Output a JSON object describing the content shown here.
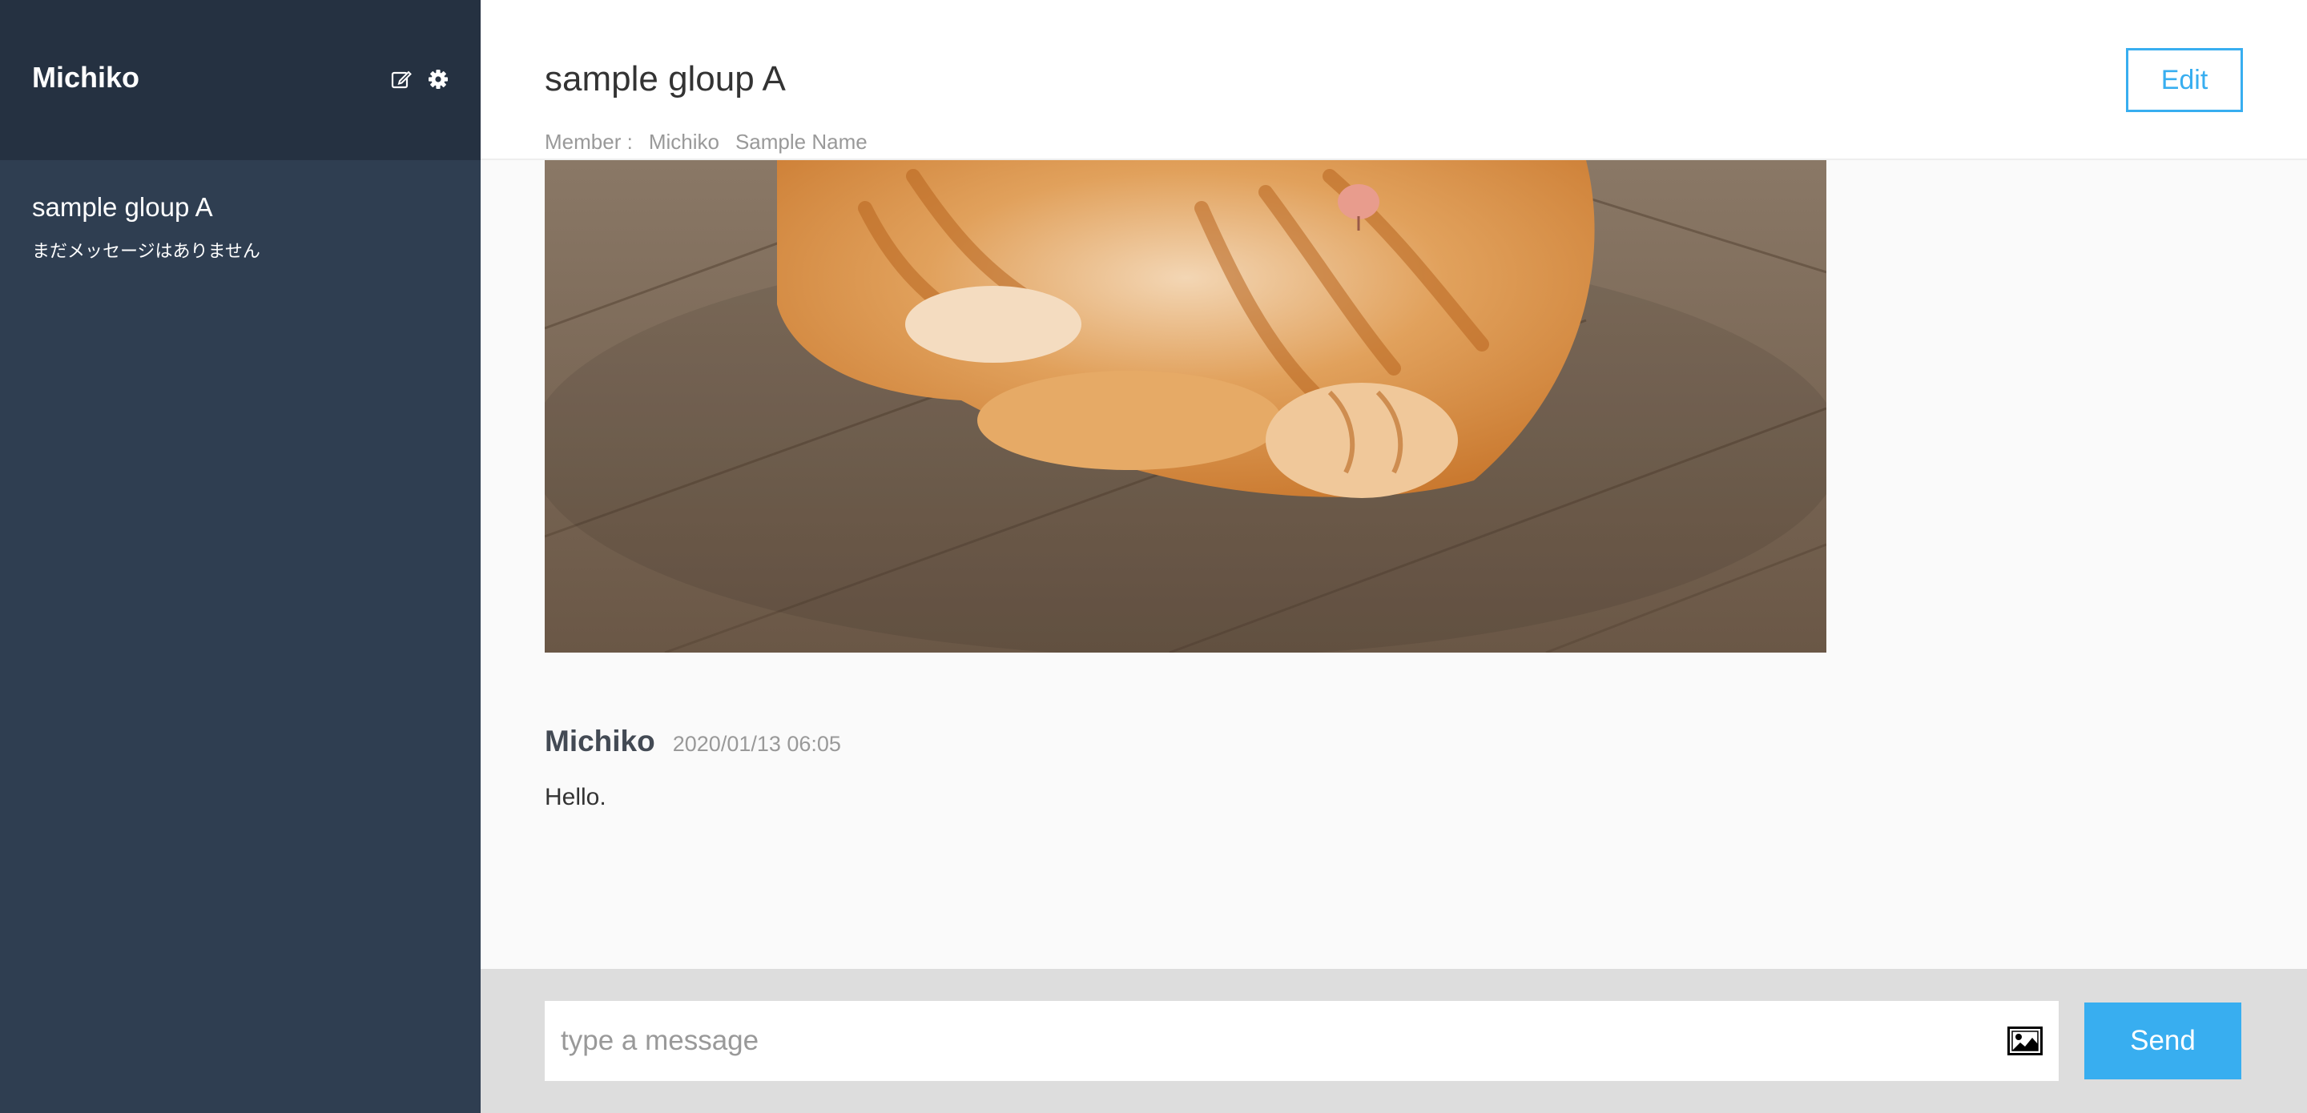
{
  "sidebar": {
    "user_name": "Michiko",
    "icons": {
      "edit": "edit-icon",
      "settings": "gear-icon"
    },
    "groups": [
      {
        "name": "sample gloup A",
        "last_message": "まだメッセージはありません"
      }
    ]
  },
  "header": {
    "group_name": "sample gloup A",
    "member_label": "Member :",
    "members": [
      "Michiko",
      "Sample Name"
    ],
    "edit_label": "Edit"
  },
  "messages": [
    {
      "type": "image",
      "image": "orange-tabby-cat-photo"
    },
    {
      "user": "Michiko",
      "date": "2020/01/13 06:05",
      "text": "Hello."
    }
  ],
  "form": {
    "placeholder": "type a message",
    "value": "",
    "image_icon": "image-icon",
    "send_label": "Send"
  },
  "colors": {
    "sidebar_bg": "#2f3e51",
    "sidebar_header_bg": "#253141",
    "accent": "#38aef0",
    "footer_bg": "#dddddd"
  }
}
